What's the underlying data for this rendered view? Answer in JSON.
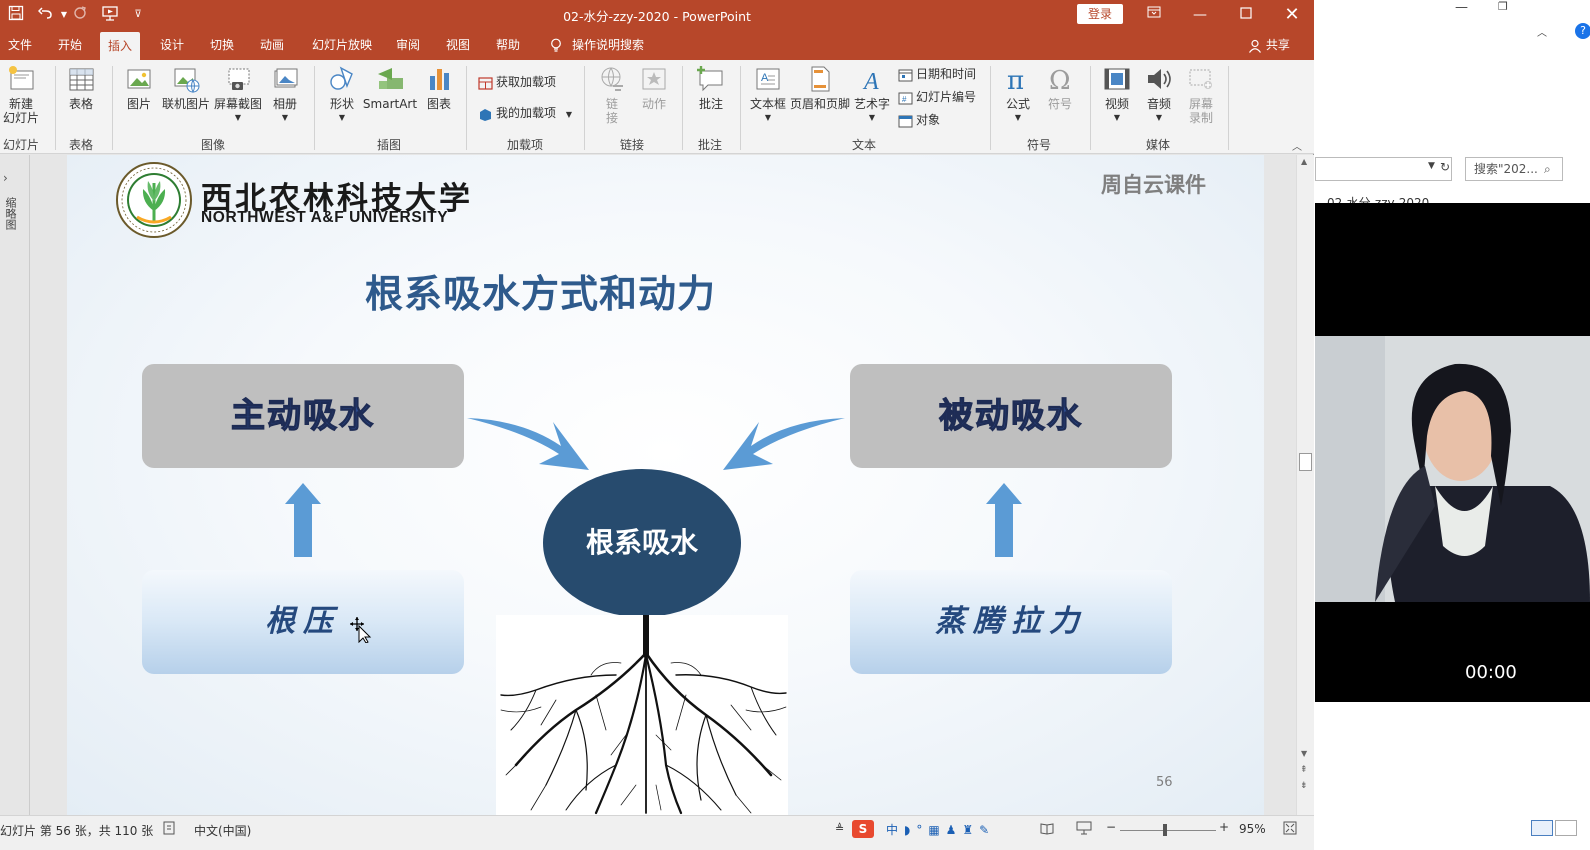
{
  "window": {
    "title": "02-水分-zzy-2020  -  PowerPoint",
    "login": "登录",
    "share": "共享"
  },
  "tabs": [
    {
      "label": "文件"
    },
    {
      "label": "开始"
    },
    {
      "label": "插入",
      "active": true
    },
    {
      "label": "设计"
    },
    {
      "label": "切换"
    },
    {
      "label": "动画"
    },
    {
      "label": "幻灯片放映"
    },
    {
      "label": "审阅"
    },
    {
      "label": "视图"
    },
    {
      "label": "帮助"
    },
    {
      "label": "操作说明搜索"
    }
  ],
  "ribbon": {
    "new_slide": "新建\n幻灯片",
    "table": "表格",
    "picture": "图片",
    "online_picture": "联机图片",
    "screenshot": "屏幕截图",
    "album": "相册",
    "shapes": "形状",
    "smartart": "SmartArt",
    "chart": "图表",
    "get_addins": "获取加载项",
    "my_addins": "我的加载项",
    "link": "链\n接",
    "action": "动作",
    "comment": "批注",
    "textbox": "文本框",
    "header_footer": "页眉和页脚",
    "wordart": "艺术字",
    "date_time": "日期和时间",
    "slide_number": "幻灯片编号",
    "object": "对象",
    "equation": "公式",
    "symbol": "符号",
    "video": "视频",
    "audio": "音频",
    "screen_record": "屏幕\n录制",
    "groups": {
      "slides": "幻灯片",
      "tables": "表格",
      "images": "图像",
      "illustrations": "插图",
      "addins": "加载项",
      "links": "链接",
      "comments": "批注",
      "text": "文本",
      "symbols": "符号",
      "media": "媒体"
    }
  },
  "left_pane": {
    "label": "缩略图"
  },
  "slide": {
    "university_cn": "西北农林科技大学",
    "university_en": "NORTHWEST A&F UNIVERSITY",
    "course_tag": "周自云课件",
    "heading": "根系吸水方式和动力",
    "active": "主动吸水",
    "passive": "被动吸水",
    "center": "根系吸水",
    "root_pressure": "根压",
    "transpiration": "蒸腾拉力",
    "page_number": "56"
  },
  "status": {
    "slide_info": "幻灯片 第 56 张，共 110 张",
    "language": "中文(中国)",
    "zoom": "95%"
  },
  "right_app": {
    "search_placeholder": "搜索\"202...",
    "file_label": "02-水分-zzy-2020",
    "timer": "00:00"
  },
  "colors": {
    "ppt_accent": "#b7472a",
    "slide_heading": "#2e5a8c",
    "ellipse": "#274b6e",
    "arrow_blue": "#5b9bd5"
  }
}
